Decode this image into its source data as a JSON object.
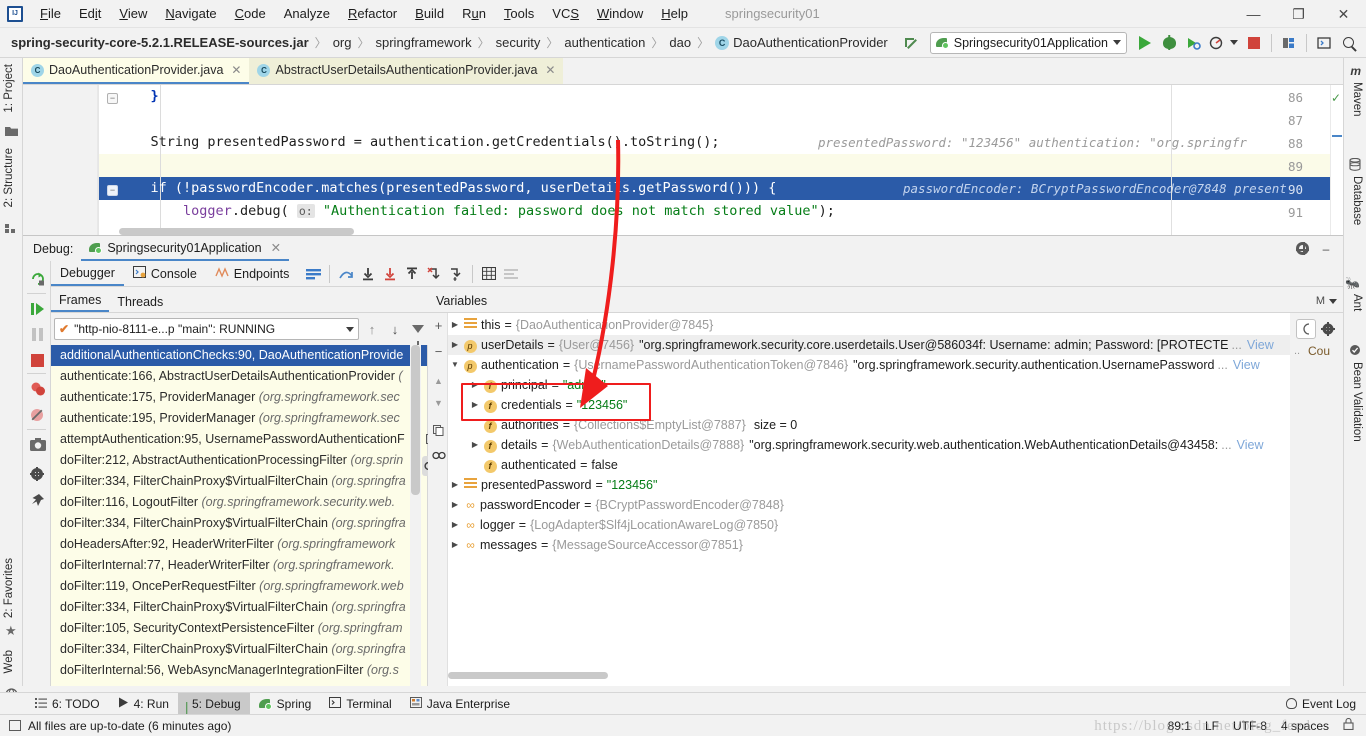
{
  "titlebar": {
    "menus": [
      "File",
      "Edit",
      "View",
      "Navigate",
      "Code",
      "Analyze",
      "Refactor",
      "Build",
      "Run",
      "Tools",
      "VCS",
      "Window",
      "Help"
    ],
    "project_name": "springsecurity01",
    "minimize": "—",
    "maximize": "❐",
    "close": "✕"
  },
  "breadcrumb": {
    "root": "spring-security-core-5.2.1.RELEASE-sources.jar",
    "items": [
      "org",
      "springframework",
      "security",
      "authentication",
      "dao"
    ],
    "class_badge": "C",
    "class_name": "DaoAuthenticationProvider",
    "separator": "〉"
  },
  "toolbar": {
    "run_config": "Springsecurity01Application",
    "run_tooltip": "Run",
    "debug_tooltip": "Debug",
    "coverage_tooltip": "Run with Coverage",
    "profile_tooltip": "Profile",
    "stop_tooltip": "Stop",
    "search_tooltip": "Search Everywhere"
  },
  "left_strip": [
    {
      "label": "1: Project",
      "icon": "folder-icon"
    },
    {
      "label": "2: Structure",
      "icon": "structure-icon"
    },
    {
      "label": "2: Favorites",
      "icon": "star-icon"
    },
    {
      "label": "Web",
      "icon": "globe-icon"
    }
  ],
  "right_strip": [
    {
      "label": "Maven",
      "icon": "maven-icon"
    },
    {
      "label": "Database",
      "icon": "database-icon"
    },
    {
      "label": "Ant",
      "icon": "ant-icon"
    },
    {
      "label": "Bean Validation",
      "icon": "bean-validation-icon"
    }
  ],
  "editor_tabs": [
    {
      "label": "DaoAuthenticationProvider.java",
      "badge": "C",
      "active": true
    },
    {
      "label": "AbstractUserDetailsAuthenticationProvider.java",
      "badge": "C",
      "active": false
    }
  ],
  "editor": {
    "lines": [
      {
        "num": "86",
        "code": "    }"
      },
      {
        "num": "87",
        "code": ""
      },
      {
        "num": "88",
        "code": "    String presentedPassword = authentication.getCredentials().toString();"
      },
      {
        "num": "89",
        "code": ""
      },
      {
        "num": "90",
        "code": "    if (!passwordEncoder.matches(presentedPassword, userDetails.getPassword())) {"
      },
      {
        "num": "91",
        "code": "        logger.debug( o: \"Authentication failed: password does not match stored value\");"
      }
    ],
    "hints_line88": "presentedPassword: \"123456\"   authentication: \"org.springfr",
    "hints_line90": "passwordEncoder: BCryptPasswordEncoder@7848   present",
    "logger_param_label": "o:",
    "logger_string": "\"Authentication failed: password does not match stored value\""
  },
  "debug": {
    "panel_label": "Debug:",
    "session_name": "Springsecurity01Application",
    "tabs": [
      "Debugger",
      "Console",
      "Endpoints"
    ],
    "selected_tab": "Debugger",
    "step_buttons": [
      "show-execution-point",
      "step-over",
      "step-into",
      "force-step-into",
      "step-out",
      "drop-frame",
      "run-to-cursor",
      "evaluate-expression",
      "settings"
    ]
  },
  "frames": {
    "tabs": [
      "Frames",
      "Threads"
    ],
    "selected_tab": "Frames",
    "thread": "\"http-nio-8111-e...p \"main\": RUNNING",
    "items": [
      {
        "method": "additionalAuthenticationChecks:90, DaoAuthenticationProvide",
        "pkg": "",
        "selected": true
      },
      {
        "method": "authenticate:166, AbstractUserDetailsAuthenticationProvider ",
        "pkg": "(",
        "selected": false
      },
      {
        "method": "authenticate:175, ProviderManager ",
        "pkg": "(org.springframework.sec",
        "selected": false
      },
      {
        "method": "authenticate:195, ProviderManager ",
        "pkg": "(org.springframework.sec",
        "selected": false
      },
      {
        "method": "attemptAuthentication:95, UsernamePasswordAuthenticationF",
        "pkg": "",
        "selected": false
      },
      {
        "method": "doFilter:212, AbstractAuthenticationProcessingFilter ",
        "pkg": "(org.sprin",
        "selected": false
      },
      {
        "method": "doFilter:334, FilterChainProxy$VirtualFilterChain ",
        "pkg": "(org.springfra",
        "selected": false
      },
      {
        "method": "doFilter:116, LogoutFilter ",
        "pkg": "(org.springframework.security.web.",
        "selected": false
      },
      {
        "method": "doFilter:334, FilterChainProxy$VirtualFilterChain ",
        "pkg": "(org.springfra",
        "selected": false
      },
      {
        "method": "doHeadersAfter:92, HeaderWriterFilter ",
        "pkg": "(org.springframework",
        "selected": false
      },
      {
        "method": "doFilterInternal:77, HeaderWriterFilter ",
        "pkg": "(org.springframework.",
        "selected": false
      },
      {
        "method": "doFilter:119, OncePerRequestFilter ",
        "pkg": "(org.springframework.web",
        "selected": false
      },
      {
        "method": "doFilter:334, FilterChainProxy$VirtualFilterChain ",
        "pkg": "(org.springfra",
        "selected": false
      },
      {
        "method": "doFilter:105, SecurityContextPersistenceFilter ",
        "pkg": "(org.springfram",
        "selected": false
      },
      {
        "method": "doFilter:334, FilterChainProxy$VirtualFilterChain ",
        "pkg": "(org.springfra",
        "selected": false
      },
      {
        "method": "doFilterInternal:56, WebAsyncManagerIntegrationFilter ",
        "pkg": "(org.s",
        "selected": false
      }
    ]
  },
  "variables": {
    "title": "Variables",
    "rows": [
      {
        "indent": 0,
        "twisty": "▶",
        "icon": "equals-icon",
        "name": "this",
        "eq": "=",
        "ref": "{DaoAuthenticationProvider@7845}",
        "value": "",
        "view": ""
      },
      {
        "indent": 0,
        "twisty": "▶",
        "icon": "p-badge",
        "name": "userDetails",
        "eq": "=",
        "ref": "{User@7456}",
        "value": "\"org.springframework.security.core.userdetails.User@586034f: Username: admin; Password: [PROTECTE",
        "ellipsis": "...",
        "view": "View"
      },
      {
        "indent": 0,
        "twisty": "▼",
        "icon": "p-badge",
        "name": "authentication",
        "eq": "=",
        "ref": "{UsernamePasswordAuthenticationToken@7846}",
        "value": "\"org.springframework.security.authentication.UsernamePassword",
        "ellipsis": "...",
        "view": "View"
      },
      {
        "indent": 1,
        "twisty": "▶",
        "icon": "f-badge",
        "name": "principal",
        "eq": "=",
        "ref": "",
        "value": "\"admin\"",
        "view": ""
      },
      {
        "indent": 1,
        "twisty": "▶",
        "icon": "f-badge",
        "name": "credentials",
        "eq": "=",
        "ref": "",
        "value": "\"123456\"",
        "view": ""
      },
      {
        "indent": 1,
        "twisty": "",
        "icon": "f-badge",
        "name": "authorities",
        "eq": "=",
        "ref": "{Collections$EmptyList@7887}",
        "value": "size = 0",
        "view": ""
      },
      {
        "indent": 1,
        "twisty": "▶",
        "icon": "f-badge",
        "name": "details",
        "eq": "=",
        "ref": "{WebAuthenticationDetails@7888}",
        "value": "\"org.springframework.security.web.authentication.WebAuthenticationDetails@43458:",
        "ellipsis": "...",
        "view": "View"
      },
      {
        "indent": 1,
        "twisty": "",
        "icon": "f-badge",
        "name": "authenticated",
        "eq": "=",
        "ref": "",
        "value": "false",
        "view": ""
      },
      {
        "indent": 0,
        "twisty": "▶",
        "icon": "equals-icon",
        "name": "presentedPassword",
        "eq": "=",
        "ref": "",
        "value": "\"123456\"",
        "view": ""
      },
      {
        "indent": 0,
        "twisty": "▶",
        "icon": "link-icon",
        "name": "passwordEncoder",
        "eq": "=",
        "ref": "{BCryptPasswordEncoder@7848}",
        "value": "",
        "view": ""
      },
      {
        "indent": 0,
        "twisty": "▶",
        "icon": "link-icon",
        "name": "logger",
        "eq": "=",
        "ref": "{LogAdapter$Slf4jLocationAwareLog@7850}",
        "value": "",
        "view": ""
      },
      {
        "indent": 0,
        "twisty": "▶",
        "icon": "link-icon",
        "name": "messages",
        "eq": "=",
        "ref": "{MessageSourceAccessor@7851}",
        "value": "",
        "view": ""
      }
    ],
    "side_label": "Cou",
    "header_mode": "M"
  },
  "annotation": {
    "box_color": "#ef1d1d",
    "arrow_color": "#ef1d1d",
    "description": "red-highlight-principal-credentials"
  },
  "bottom_tools": [
    {
      "label": "6: TODO",
      "icon": "todo-icon",
      "active": false
    },
    {
      "label": "4: Run",
      "icon": "run-icon",
      "active": false
    },
    {
      "label": "5: Debug",
      "icon": "debug-icon",
      "active": true
    },
    {
      "label": "Spring",
      "icon": "spring-leaf-icon",
      "active": false
    },
    {
      "label": "Terminal",
      "icon": "terminal-icon",
      "active": false
    },
    {
      "label": "Java Enterprise",
      "icon": "java-enterprise-icon",
      "active": false
    }
  ],
  "event_log": "Event Log",
  "statusbar": {
    "message": "All files are up-to-date (6 minutes ago)",
    "caret": "89:1",
    "line_sep": "LF",
    "encoding": "UTF-8",
    "indent": "4 spaces",
    "watermark": "https://blog.csdn.net/blog_feed"
  }
}
